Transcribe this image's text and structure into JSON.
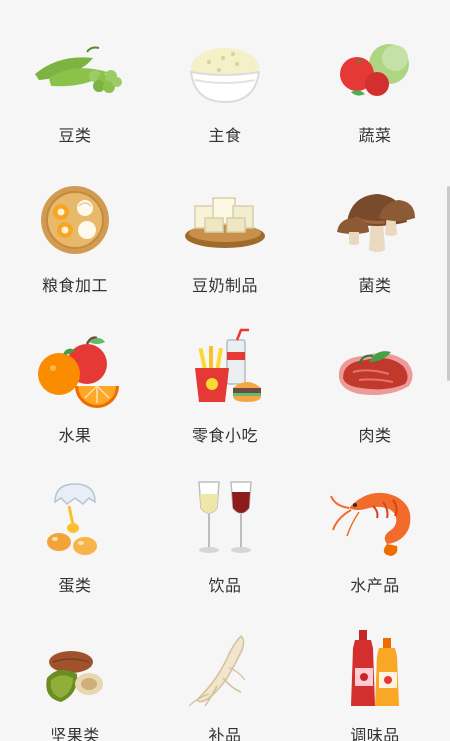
{
  "categories": [
    {
      "label": "豆类",
      "icon": "peas-icon"
    },
    {
      "label": "主食",
      "icon": "rice-bowl-icon"
    },
    {
      "label": "蔬菜",
      "icon": "vegetables-icon"
    },
    {
      "label": "粮食加工",
      "icon": "dumplings-icon"
    },
    {
      "label": "豆奶制品",
      "icon": "tofu-icon"
    },
    {
      "label": "菌类",
      "icon": "mushroom-icon"
    },
    {
      "label": "水果",
      "icon": "fruit-icon"
    },
    {
      "label": "零食小吃",
      "icon": "snacks-icon"
    },
    {
      "label": "肉类",
      "icon": "meat-icon"
    },
    {
      "label": "蛋类",
      "icon": "egg-icon"
    },
    {
      "label": "饮品",
      "icon": "wine-glass-icon"
    },
    {
      "label": "水产品",
      "icon": "shrimp-icon"
    },
    {
      "label": "坚果类",
      "icon": "nuts-icon"
    },
    {
      "label": "补品",
      "icon": "ginseng-icon"
    },
    {
      "label": "调味品",
      "icon": "condiment-bottles-icon"
    }
  ]
}
